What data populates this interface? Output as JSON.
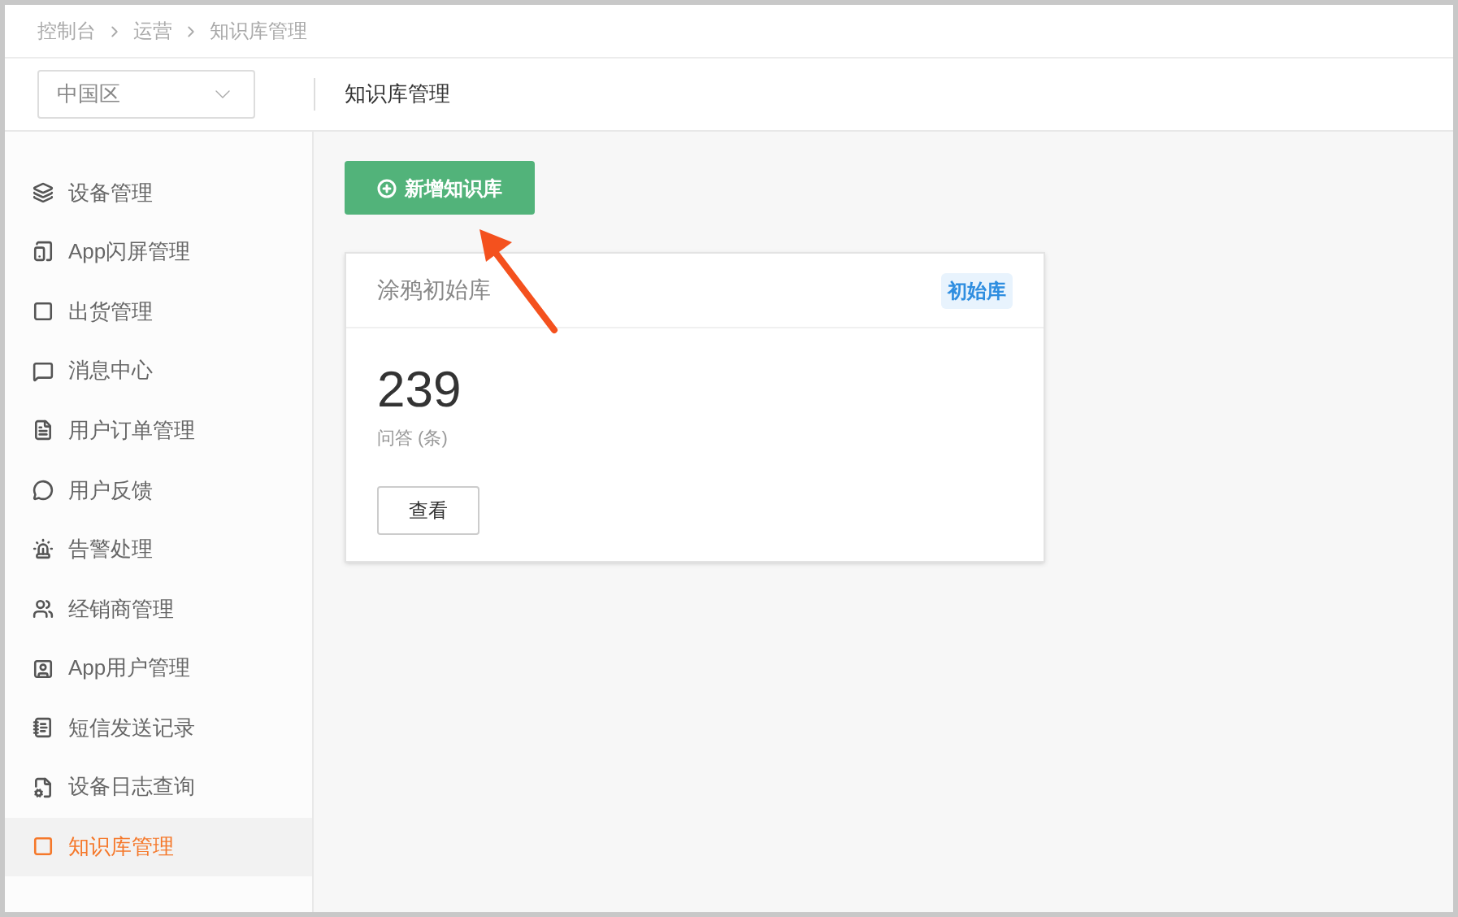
{
  "breadcrumb": [
    "控制台",
    "运营",
    "知识库管理"
  ],
  "region_select": {
    "value": "中国区"
  },
  "page_title": "知识库管理",
  "sidebar": {
    "items": [
      {
        "label": "设备管理",
        "selected": false
      },
      {
        "label": "App闪屏管理",
        "selected": false
      },
      {
        "label": "出货管理",
        "selected": false
      },
      {
        "label": "消息中心",
        "selected": false
      },
      {
        "label": "用户订单管理",
        "selected": false
      },
      {
        "label": "用户反馈",
        "selected": false
      },
      {
        "label": "告警处理",
        "selected": false
      },
      {
        "label": "经销商管理",
        "selected": false
      },
      {
        "label": "App用户管理",
        "selected": false
      },
      {
        "label": "短信发送记录",
        "selected": false
      },
      {
        "label": "设备日志查询",
        "selected": false
      },
      {
        "label": "知识库管理",
        "selected": true
      }
    ]
  },
  "add_button": "新增知识库",
  "cards": [
    {
      "title": "涂鸦初始库",
      "tag": "初始库",
      "count": "239",
      "count_label": "问答 (条)",
      "view_button": "查看"
    }
  ]
}
